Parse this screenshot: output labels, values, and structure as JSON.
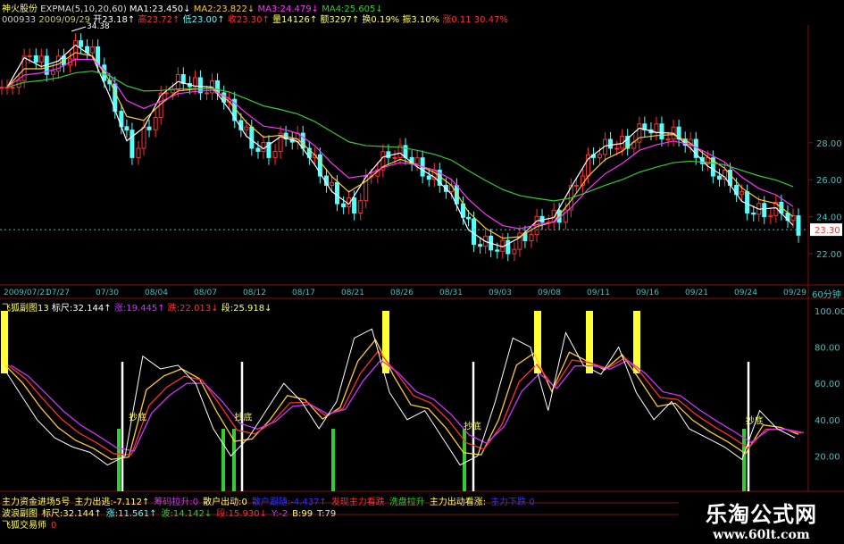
{
  "header": {
    "stock": "神火股份",
    "indicator": "EXPMA(5,10,20,60)",
    "ma1": "MA1:23.450↓",
    "ma2": "MA2:23.822↓",
    "ma3": "MA3:24.479↓",
    "ma4": "MA4:25.605↓",
    "code": "000933",
    "date": "2009/09/29",
    "open": "开23.18↑",
    "high": "高23.72↑",
    "low": "低23.00↑",
    "close": "收23.30↑",
    "volume": "量14126↑",
    "amount": "额3297↑",
    "turnover": "换0.19%",
    "amplitude": "振3.10%",
    "change": "涨0.11 30.47%"
  },
  "sub_header": {
    "name": "飞狐副图13",
    "scale": "标尺:32.144↑",
    "rise": "涨:19.445↑",
    "fall": "跌:22.013↓",
    "segment": "段:25.918↓"
  },
  "bottom": {
    "line1": [
      "主力资金进场5号",
      "主力出逃:-7.112↑",
      "筹码拉升:0",
      "散户出动:0",
      "散户跟随:-4.437↑",
      "发现主力看跌",
      "洗盘拉升",
      "主力出动看涨:",
      "主力下跌 0"
    ],
    "line2": [
      "波浪副图",
      "标尺:32.144↑",
      "涨:11.561↑",
      "波:14.142↓",
      "段:15.930↓",
      "Y:-2",
      "B:99",
      "T:79"
    ],
    "line3": [
      "飞狐交易师",
      "0"
    ]
  },
  "watermark": {
    "title": "乐淘公式网",
    "url": "www.60lt.com"
  },
  "period": "60分钟",
  "colors": {
    "up": "#ff3030",
    "down": "#54ffff",
    "ma1": "#ffffff",
    "ma2": "#ffcc33",
    "ma3": "#ff33ff",
    "ma4": "#33cc33",
    "grid": "#801010",
    "axis": "#40c0c0"
  },
  "chart_data": [
    {
      "type": "candlestick",
      "title": "神火股份 EXPMA(5,10,20,60)",
      "ylim": [
        21,
        34.5
      ],
      "y_ticks": [
        "28.00",
        "26.00",
        "24.00",
        "22.00"
      ],
      "last_price": "23.30",
      "peak_label": "34.38",
      "x_ticks": [
        "2009/07/21",
        "07/27",
        "07/30",
        "08/04",
        "08/07",
        "08/12",
        "08/17",
        "08/21",
        "08/26",
        "08/31",
        "09/03",
        "09/08",
        "09/11",
        "09/16",
        "09/21",
        "09/24",
        "09/29"
      ],
      "close": [
        31,
        33,
        32,
        32.5,
        33.5,
        32.5,
        30,
        27.5,
        29,
        31,
        31.5,
        31,
        31,
        29.5,
        28,
        27.5,
        28.5,
        28,
        26.5,
        25,
        24.5,
        26.5,
        27.5,
        27.5,
        26.5,
        26,
        25,
        22.8,
        22.5,
        22.3,
        23,
        24,
        24,
        26,
        27.5,
        28,
        28,
        29,
        28.5,
        28.5,
        27.5,
        26.5,
        26,
        24.5,
        24.3,
        24.5,
        23.3
      ]
    },
    {
      "type": "line",
      "title": "飞狐副图13",
      "ylim": [
        0,
        105
      ],
      "y_ticks": [
        "100.00",
        "80.00",
        "60.00",
        "40.00",
        "20.00"
      ],
      "values": [
        70,
        55,
        40,
        30,
        25,
        22,
        15,
        20,
        75,
        68,
        70,
        60,
        35,
        20,
        30,
        45,
        60,
        50,
        35,
        50,
        85,
        90,
        55,
        40,
        45,
        30,
        15,
        20,
        50,
        85,
        80,
        45,
        88,
        70,
        65,
        80,
        55,
        40,
        50,
        35,
        30,
        25,
        18,
        45,
        35,
        30
      ],
      "signal_label": "抄底",
      "signal_points": [
        7,
        13,
        26,
        42
      ]
    }
  ]
}
